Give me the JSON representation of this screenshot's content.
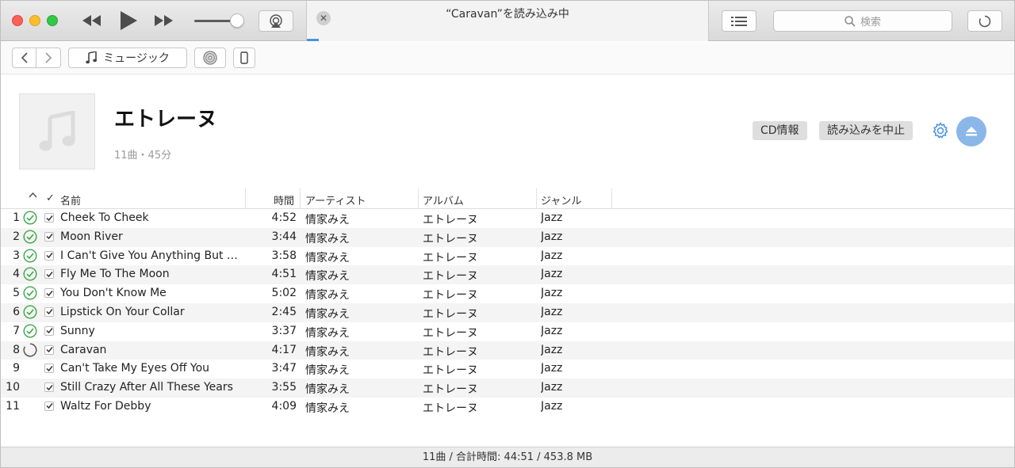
{
  "window": {
    "lcd_title": "“Caravan”を読み込み中",
    "import_progress": 0.03,
    "search_placeholder": "検索"
  },
  "nav": {
    "media_label": "ミュージック"
  },
  "album": {
    "title": "エトレーヌ",
    "subtitle": "11曲・45分",
    "cd_info_label": "CD情報",
    "stop_import_label": "読み込みを中止"
  },
  "table": {
    "columns": {
      "check": "✓",
      "name": "名前",
      "time": "時間",
      "artist": "アーティスト",
      "album": "アルバム",
      "genre": "ジャンル"
    },
    "rows": [
      {
        "num": "1",
        "status": "done",
        "name": "Cheek To Cheek",
        "time": "4:52",
        "artist": "情家みえ",
        "album": "エトレーヌ",
        "genre": "Jazz"
      },
      {
        "num": "2",
        "status": "done",
        "name": "Moon River",
        "time": "3:44",
        "artist": "情家みえ",
        "album": "エトレーヌ",
        "genre": "Jazz"
      },
      {
        "num": "3",
        "status": "done",
        "name": "I Can't Give You Anything But L...",
        "time": "3:58",
        "artist": "情家みえ",
        "album": "エトレーヌ",
        "genre": "Jazz"
      },
      {
        "num": "4",
        "status": "done",
        "name": "Fly Me To The Moon",
        "time": "4:51",
        "artist": "情家みえ",
        "album": "エトレーヌ",
        "genre": "Jazz"
      },
      {
        "num": "5",
        "status": "done",
        "name": "You Don't Know Me",
        "time": "5:02",
        "artist": "情家みえ",
        "album": "エトレーヌ",
        "genre": "Jazz"
      },
      {
        "num": "6",
        "status": "done",
        "name": "Lipstick On Your Collar",
        "time": "2:45",
        "artist": "情家みえ",
        "album": "エトレーヌ",
        "genre": "Jazz"
      },
      {
        "num": "7",
        "status": "done",
        "name": "Sunny",
        "time": "3:37",
        "artist": "情家みえ",
        "album": "エトレーヌ",
        "genre": "Jazz"
      },
      {
        "num": "8",
        "status": "importing",
        "name": "Caravan",
        "time": "4:17",
        "artist": "情家みえ",
        "album": "エトレーヌ",
        "genre": "Jazz"
      },
      {
        "num": "9",
        "status": "none",
        "name": "Can't Take My Eyes Off You",
        "time": "3:47",
        "artist": "情家みえ",
        "album": "エトレーヌ",
        "genre": "Jazz"
      },
      {
        "num": "10",
        "status": "none",
        "name": "Still Crazy After All These Years",
        "time": "3:55",
        "artist": "情家みえ",
        "album": "エトレーヌ",
        "genre": "Jazz"
      },
      {
        "num": "11",
        "status": "none",
        "name": "Waltz For Debby",
        "time": "4:09",
        "artist": "情家みえ",
        "album": "エトレーヌ",
        "genre": "Jazz"
      }
    ]
  },
  "status_bar": {
    "summary": "11曲 / 合計時間: 44:51 / 453.8 MB"
  },
  "colors": {
    "accent": "#4a90e2",
    "done_green": "#3aa845",
    "eject_blue": "#8ab7e8"
  }
}
